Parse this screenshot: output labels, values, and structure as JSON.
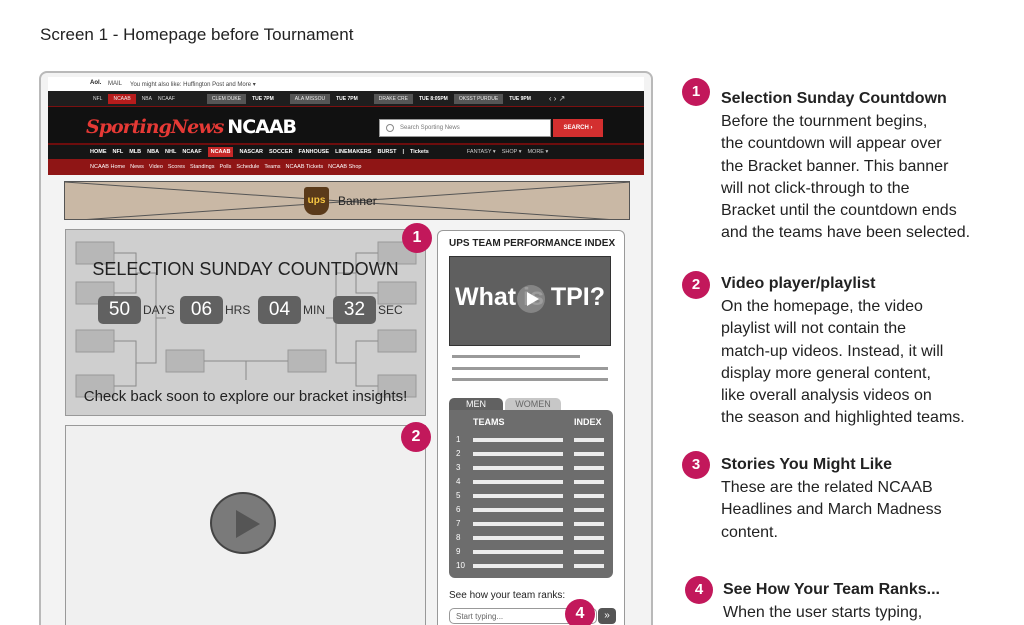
{
  "screen_title": "Screen 1  - Homepage before Tournament",
  "site": {
    "aol": "Aol.",
    "topstrip": [
      "MAIL",
      "You might also like: Huffington Post and More ▾"
    ],
    "scorebar": {
      "leagues": [
        "NFL",
        "NCAAB",
        "NBA",
        "NCAAF"
      ],
      "games": [
        {
          "teams": "CLEM  DUKE",
          "time": "TUE 7PM"
        },
        {
          "teams": "ALA  MISSOU",
          "time": "TUE 7PM"
        },
        {
          "teams": "DRAKE  CRE",
          "time": "TUE 8:05PM"
        },
        {
          "teams": "OKSST  PURDUE",
          "time": "TUE 9PM"
        }
      ],
      "arrows": "‹ › ↗"
    },
    "logo_brand": "SportingNews",
    "logo_section": "NCAAB",
    "search_placeholder": "Search Sporting News",
    "search_button": "SEARCH ›",
    "nav": [
      "HOME",
      "NFL",
      "MLB",
      "NBA",
      "NHL",
      "NCAAF",
      "NCAAB",
      "NASCAR",
      "SOCCER",
      "FANHOUSE",
      "LINEMAKERS",
      "BURST",
      "|",
      "Tickets"
    ],
    "nav_active": "NCAAB",
    "nav_right": [
      "FANTASY ▾",
      "SHOP ▾",
      "MORE ▾"
    ],
    "subnav": [
      "NCAAB Home",
      "News",
      "Video",
      "Scores",
      "Standings",
      "Polls",
      "Schedule",
      "Teams",
      "NCAAB Tickets",
      "NCAAB Shop"
    ]
  },
  "banner": {
    "logo": "ups",
    "label": "Banner"
  },
  "countdown": {
    "title": "SELECTION SUNDAY COUNTDOWN",
    "units": [
      {
        "value": "50",
        "label": "DAYS"
      },
      {
        "value": "06",
        "label": "HRS"
      },
      {
        "value": "04",
        "label": "MIN"
      },
      {
        "value": "32",
        "label": "SEC"
      }
    ],
    "note": "Check back soon to explore our bracket insights!"
  },
  "tpi": {
    "title": "UPS TEAM PERFORMANCE INDEX",
    "video_text": "What is TPI?",
    "tabs": [
      "MEN",
      "WOMEN"
    ],
    "col_teams": "TEAMS",
    "col_index": "INDEX",
    "ranks": [
      "1",
      "2",
      "3",
      "4",
      "5",
      "6",
      "7",
      "8",
      "9",
      "10"
    ],
    "rank_label": "See how your team ranks:",
    "rank_placeholder": "Start typing...",
    "go": "»"
  },
  "markers": [
    "1",
    "2",
    "4"
  ],
  "annotations": [
    {
      "num": "1",
      "title": "Selection Sunday Countdown",
      "body": "Before the tournment begins,\nthe countdown will appear over\nthe Bracket banner.  This banner\nwill not click-through to the\nBracket until the countdown ends\nand the teams have been selected."
    },
    {
      "num": "2",
      "title": "Video player/playlist",
      "body": "On the homepage, the video\nplaylist will not contain the\nmatch-up videos. Instead, it will\ndisplay more general content,\nlike overall analysis videos on\nthe season and highlighted teams."
    },
    {
      "num": "3",
      "title": "Stories You Might Like",
      "body": "These are the related NCAAB\nHeadlines and March Madness\ncontent."
    },
    {
      "num": "4",
      "title": "See How Your Team Ranks...",
      "body": "When the user starts typing,"
    }
  ],
  "colors": {
    "accent": "#c2185b",
    "brand_red": "#d32f2f",
    "dark": "#111111"
  }
}
